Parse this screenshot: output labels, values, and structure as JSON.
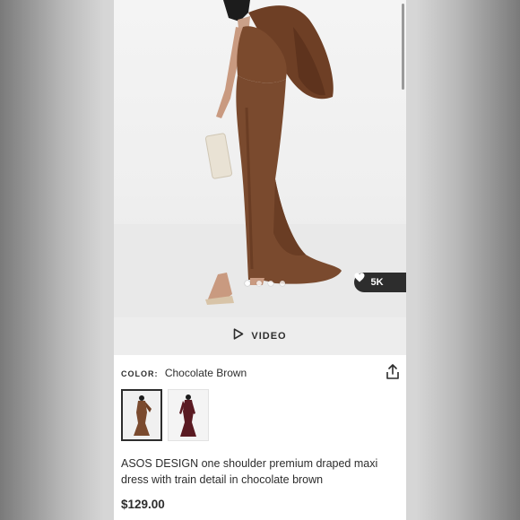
{
  "media": {
    "likes_count": "5K",
    "heart_icon": "heart-icon",
    "carousel": {
      "total": 4,
      "active_index": 0
    }
  },
  "video": {
    "label": "VIDEO",
    "icon": "play-icon"
  },
  "product": {
    "color_key": "COLOR:",
    "color_value": "Chocolate Brown",
    "share_icon": "share-icon",
    "swatches": [
      "chocolate-brown",
      "burgundy"
    ],
    "title": "ASOS DESIGN one shoulder premium draped maxi dress with train detail in chocolate brown",
    "price": "$129.00"
  },
  "colors": {
    "dress": "#7a4a2e",
    "accent_dark": "#2d2d2d"
  }
}
